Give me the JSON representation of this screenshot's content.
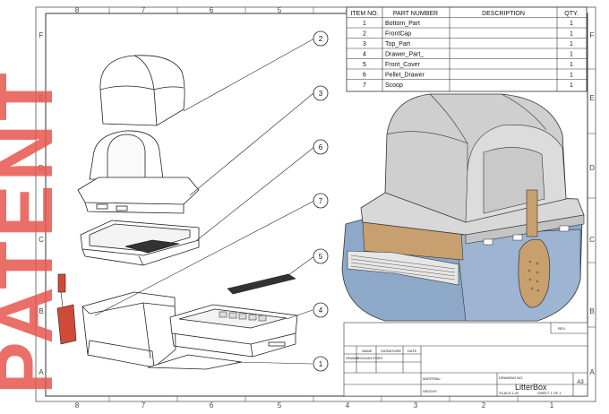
{
  "watermark": "PATENT",
  "border": {
    "columns": [
      "8",
      "7",
      "6",
      "5",
      "4",
      "3",
      "2",
      "1"
    ],
    "rows": [
      "F",
      "E",
      "D",
      "C",
      "B",
      "A"
    ]
  },
  "bom": {
    "headers": {
      "item": "ITEM NO.",
      "part": "PART NUMBER",
      "desc": "DESCRIPTION",
      "qty": "QTY."
    },
    "rows": [
      {
        "item": "1",
        "part": "Bottom_Part",
        "desc": "",
        "qty": "1"
      },
      {
        "item": "2",
        "part": "FrontCap",
        "desc": "",
        "qty": "1"
      },
      {
        "item": "3",
        "part": "Top_Part",
        "desc": "",
        "qty": "1"
      },
      {
        "item": "4",
        "part": "Drawer_Part_",
        "desc": "",
        "qty": "1"
      },
      {
        "item": "5",
        "part": "Front_Cover",
        "desc": "",
        "qty": "1"
      },
      {
        "item": "6",
        "part": "Pellet_Drawer",
        "desc": "",
        "qty": "1"
      },
      {
        "item": "7",
        "part": "Scoop",
        "desc": "",
        "qty": "1"
      }
    ]
  },
  "balloons": [
    "2",
    "3",
    "6",
    "7",
    "5",
    "4",
    "1"
  ],
  "title_block": {
    "rev": "REV.",
    "name": "NAME",
    "signature": "SIGNATURE",
    "date": "DATE",
    "drawn_label": "DRAWN",
    "drawn_by": "VOLKAN ESER",
    "material": "MATERIAL:",
    "weight": "WEIGHT:",
    "dwg_no_label": "DRAWING NO.",
    "title": "LitterBox",
    "size": "A3",
    "scale": "SCALE:1:20",
    "sheet": "SHEET 1 OF 1"
  },
  "colors": {
    "watermark": "#e8564f",
    "base_blue": "#8ea8c8",
    "dome_grey": "#cfcfcf",
    "pellet_brown": "#c8a070",
    "line": "#222222"
  }
}
